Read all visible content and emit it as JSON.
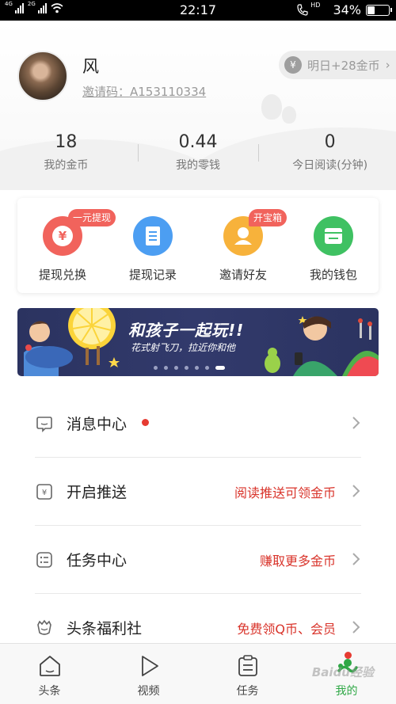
{
  "status_bar": {
    "network_left": "4G",
    "network_right": "2G",
    "time": "22:17",
    "hd_label": "HD",
    "battery": "34%",
    "battery_level": 0.34
  },
  "profile": {
    "name": "风",
    "invite_code": "邀请码：A153110334",
    "bonus_icon": "¥",
    "bonus_text": "明日+28金币",
    "bonus_chevron": "›"
  },
  "stats": [
    {
      "value": "18",
      "label": "我的金币"
    },
    {
      "value": "0.44",
      "label": "我的零钱"
    },
    {
      "value": "0",
      "label": "今日阅读(分钟)"
    }
  ],
  "actions": [
    {
      "label": "提现兑换",
      "badge": "一元提现",
      "icon": "withdraw-icon",
      "glyph": "¥",
      "color": "#f1635c"
    },
    {
      "label": "提现记录",
      "badge": "",
      "icon": "record-icon",
      "glyph": "",
      "color": "#4c9ef2"
    },
    {
      "label": "邀请好友",
      "badge": "开宝箱",
      "icon": "invite-friend-icon",
      "glyph": "",
      "color": "#f7b23b"
    },
    {
      "label": "我的钱包",
      "badge": "",
      "icon": "wallet-icon",
      "glyph": "",
      "color": "#3fc162"
    }
  ],
  "banner": {
    "title": "和孩子一起玩!!",
    "subtitle": "花式射飞刀，拉近你和他",
    "dot_count": 7,
    "active_dot": 6
  },
  "menu": [
    {
      "title": "消息中心",
      "right_text": "",
      "has_dot": true,
      "icon": "message-icon"
    },
    {
      "title": "开启推送",
      "right_text": "阅读推送可领金币",
      "has_dot": false,
      "icon": "push-icon"
    },
    {
      "title": "任务中心",
      "right_text": "赚取更多金币",
      "has_dot": false,
      "icon": "task-list-icon"
    },
    {
      "title": "头条福利社",
      "right_text": "免费领Q币、会员",
      "has_dot": false,
      "icon": "welfare-icon"
    }
  ],
  "tabbar": {
    "tabs": [
      {
        "label": "头条",
        "icon": "home-icon",
        "active": false
      },
      {
        "label": "视频",
        "icon": "play-icon",
        "active": false
      },
      {
        "label": "任务",
        "icon": "task-icon",
        "active": false
      },
      {
        "label": "我的",
        "icon": "profile-icon",
        "active": true
      }
    ]
  },
  "colors": {
    "accent_red": "#e63b32",
    "active_green": "#2fa846",
    "banner_bg": "#2b3360"
  }
}
